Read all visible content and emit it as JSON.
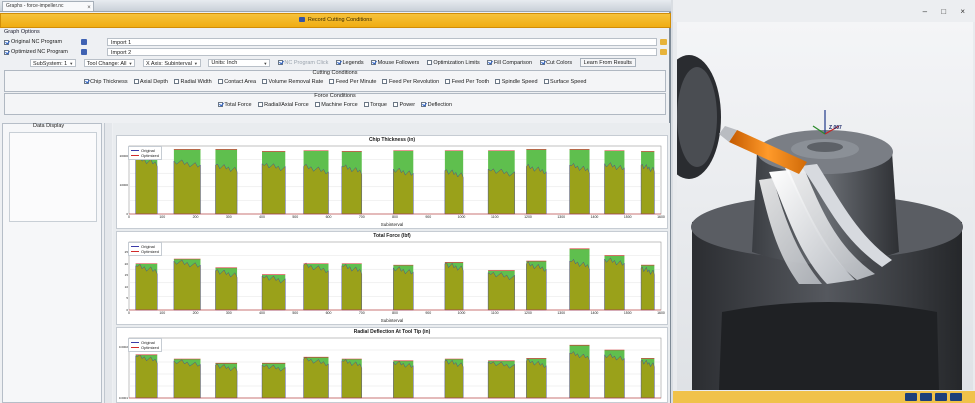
{
  "window": {
    "title": "Graphs - force-impeller.nc",
    "close_glyph": "×"
  },
  "toolbar": {
    "record_label": "Record Cutting Conditions"
  },
  "graph_options": {
    "label": "Graph Options",
    "original_nc": {
      "label": "Original NC Program",
      "value": "Import 1"
    },
    "optimized_nc": {
      "label": "Optimized NC Program",
      "value": "Import 2"
    },
    "subsystem": "SubSystem: 1",
    "tool_change": "Tool Change: All",
    "axis_subinterval": "X Axis: Subinterval",
    "units": "Units: Inch",
    "nc_program_click": "NC Program Click",
    "legends": "Legends",
    "mouse_followers": "Mouse Followers",
    "optimization_limits": "Optimization Limits",
    "fill_comparison": "Fill Comparison",
    "cut_colors": "Cut Colors",
    "learn_button": "Learn From Results"
  },
  "cutting_conditions": {
    "title": "Cutting Conditions",
    "items": [
      {
        "label": "Chip Thickness",
        "checked": true
      },
      {
        "label": "Axial Depth",
        "checked": false
      },
      {
        "label": "Radial Width",
        "checked": false
      },
      {
        "label": "Contact Area",
        "checked": false
      },
      {
        "label": "Volume Removal Rate",
        "checked": false
      },
      {
        "label": "Feed Per Minute",
        "checked": false
      },
      {
        "label": "Feed Per Revolution",
        "checked": false
      },
      {
        "label": "Feed Per Tooth",
        "checked": false
      },
      {
        "label": "Spindle Speed",
        "checked": false
      },
      {
        "label": "Surface Speed",
        "checked": false
      }
    ]
  },
  "force_conditions": {
    "title": "Force Conditions",
    "items": [
      {
        "label": "Total Force",
        "checked": true
      },
      {
        "label": "Radial/Axial Force",
        "checked": false
      },
      {
        "label": "Machine Force",
        "checked": false
      },
      {
        "label": "Torque",
        "checked": false
      },
      {
        "label": "Power",
        "checked": false
      },
      {
        "label": "Deflection",
        "checked": true
      }
    ]
  },
  "data_display": {
    "title": "Data Display"
  },
  "legend": {
    "original": "Original",
    "optimized": "Optimized"
  },
  "colors": {
    "original": "#3b3ba8",
    "optimized": "#d12a2a",
    "fill_olive": "#9aa11a",
    "fill_green": "#5fbf4e",
    "accent": "#f2b21e"
  },
  "chart_data": [
    {
      "type": "area",
      "title": "Chip Thickness (in)",
      "xlabel": "Subinterval",
      "xticks": [
        "0",
        "100",
        "200",
        "300",
        "400",
        "500",
        "600",
        "700",
        "800",
        "900",
        "1000",
        "1100",
        "1200",
        "1300",
        "1400",
        "1500",
        "1600"
      ],
      "yticks": [
        "0",
        "10000",
        "20000"
      ],
      "series_names": [
        "Original",
        "Optimized"
      ],
      "segments": [
        [
          20,
          85
        ],
        [
          135,
          215
        ],
        [
          260,
          325
        ],
        [
          400,
          470
        ],
        [
          525,
          600
        ],
        [
          640,
          700
        ],
        [
          795,
          855
        ],
        [
          950,
          1005
        ],
        [
          1080,
          1160
        ],
        [
          1195,
          1255
        ],
        [
          1325,
          1385
        ],
        [
          1430,
          1490
        ],
        [
          1540,
          1580
        ]
      ],
      "original_levels": [
        0.82,
        0.78,
        0.72,
        0.74,
        0.7,
        0.7,
        0.66,
        0.64,
        0.66,
        0.7,
        0.72,
        0.74,
        0.72
      ],
      "optimized_levels": [
        0.95,
        0.95,
        0.95,
        0.92,
        0.93,
        0.92,
        0.93,
        0.93,
        0.93,
        0.95,
        0.95,
        0.93,
        0.92
      ]
    },
    {
      "type": "area",
      "title": "Total Force (lbf)",
      "xlabel": "Subinterval",
      "xticks": [
        "0",
        "100",
        "200",
        "300",
        "400",
        "500",
        "600",
        "700",
        "800",
        "900",
        "1000",
        "1100",
        "1200",
        "1300",
        "1400",
        "1500",
        "1600"
      ],
      "yticks": [
        "0",
        "5",
        "10",
        "15",
        "20",
        "25"
      ],
      "series_names": [
        "Original",
        "Optimized"
      ],
      "segments": [
        [
          20,
          85
        ],
        [
          135,
          215
        ],
        [
          260,
          325
        ],
        [
          400,
          470
        ],
        [
          525,
          600
        ],
        [
          640,
          700
        ],
        [
          795,
          855
        ],
        [
          950,
          1005
        ],
        [
          1080,
          1160
        ],
        [
          1195,
          1255
        ],
        [
          1325,
          1385
        ],
        [
          1430,
          1490
        ],
        [
          1540,
          1580
        ]
      ],
      "original_levels": [
        0.65,
        0.72,
        0.58,
        0.5,
        0.66,
        0.65,
        0.62,
        0.68,
        0.55,
        0.68,
        0.72,
        0.75,
        0.62
      ],
      "optimized_levels": [
        0.68,
        0.75,
        0.62,
        0.52,
        0.68,
        0.68,
        0.66,
        0.7,
        0.58,
        0.72,
        0.9,
        0.8,
        0.66
      ]
    },
    {
      "type": "area",
      "title": "Radial Deflection At Tool Tip (in)",
      "xlabel": "",
      "xticks": [],
      "yticks": [
        "0.0001",
        "0.0002"
      ],
      "series_names": [
        "Original",
        "Optimized"
      ],
      "segments": [
        [
          20,
          85
        ],
        [
          135,
          215
        ],
        [
          260,
          325
        ],
        [
          400,
          470
        ],
        [
          525,
          600
        ],
        [
          640,
          700
        ],
        [
          795,
          855
        ],
        [
          950,
          1005
        ],
        [
          1080,
          1160
        ],
        [
          1195,
          1255
        ],
        [
          1325,
          1385
        ],
        [
          1430,
          1490
        ],
        [
          1540,
          1580
        ]
      ],
      "original_levels": [
        0.7,
        0.62,
        0.55,
        0.55,
        0.65,
        0.62,
        0.6,
        0.62,
        0.6,
        0.62,
        0.75,
        0.72,
        0.62
      ],
      "optimized_levels": [
        0.72,
        0.65,
        0.58,
        0.58,
        0.68,
        0.65,
        0.62,
        0.65,
        0.62,
        0.66,
        0.88,
        0.8,
        0.66
      ]
    }
  ],
  "viewport": {
    "controls": "– □ ×",
    "axis_label": "Z 007"
  }
}
